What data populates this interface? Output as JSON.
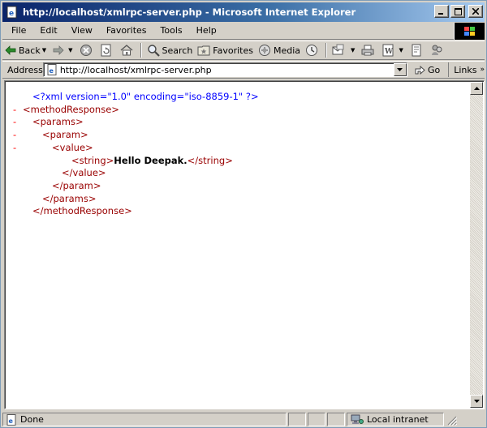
{
  "window": {
    "title": "http://localhost/xmlrpc-server.php - Microsoft Internet Explorer"
  },
  "menubar": {
    "items": [
      "File",
      "Edit",
      "View",
      "Favorites",
      "Tools",
      "Help"
    ]
  },
  "toolbar": {
    "back_label": "Back",
    "search_label": "Search",
    "favorites_label": "Favorites",
    "media_label": "Media"
  },
  "addressbar": {
    "label": "Address",
    "url": "http://localhost/xmlrpc-server.php",
    "go_label": "Go",
    "links_label": "Links"
  },
  "document": {
    "lines": [
      {
        "minus": "",
        "indent": 1,
        "kind": "pi",
        "text": "<?xml version=\"1.0\" encoding=\"iso-8859-1\" ?>"
      },
      {
        "minus": "-",
        "indent": 0,
        "kind": "tag",
        "text": "<methodResponse>"
      },
      {
        "minus": "-",
        "indent": 1,
        "kind": "tag",
        "text": "<params>"
      },
      {
        "minus": "-",
        "indent": 2,
        "kind": "tag",
        "text": "<param>"
      },
      {
        "minus": "-",
        "indent": 3,
        "kind": "tag",
        "text": "<value>"
      },
      {
        "minus": "",
        "indent": 5,
        "kind": "mixed",
        "open": "<string>",
        "text": "Hello Deepak.",
        "close": "</string>"
      },
      {
        "minus": "",
        "indent": 4,
        "kind": "tag",
        "text": "</value>"
      },
      {
        "minus": "",
        "indent": 3,
        "kind": "tag",
        "text": "</param>"
      },
      {
        "minus": "",
        "indent": 2,
        "kind": "tag",
        "text": "</params>"
      },
      {
        "minus": "",
        "indent": 1,
        "kind": "tag",
        "text": "</methodResponse>"
      }
    ]
  },
  "statusbar": {
    "status": "Done",
    "zone": "Local intranet"
  },
  "colors": {
    "title_start": "#0a246a",
    "title_end": "#a6caf0",
    "xml_pi": "#0000ff",
    "xml_tag": "#990000",
    "xml_minus": "#ff0000"
  }
}
